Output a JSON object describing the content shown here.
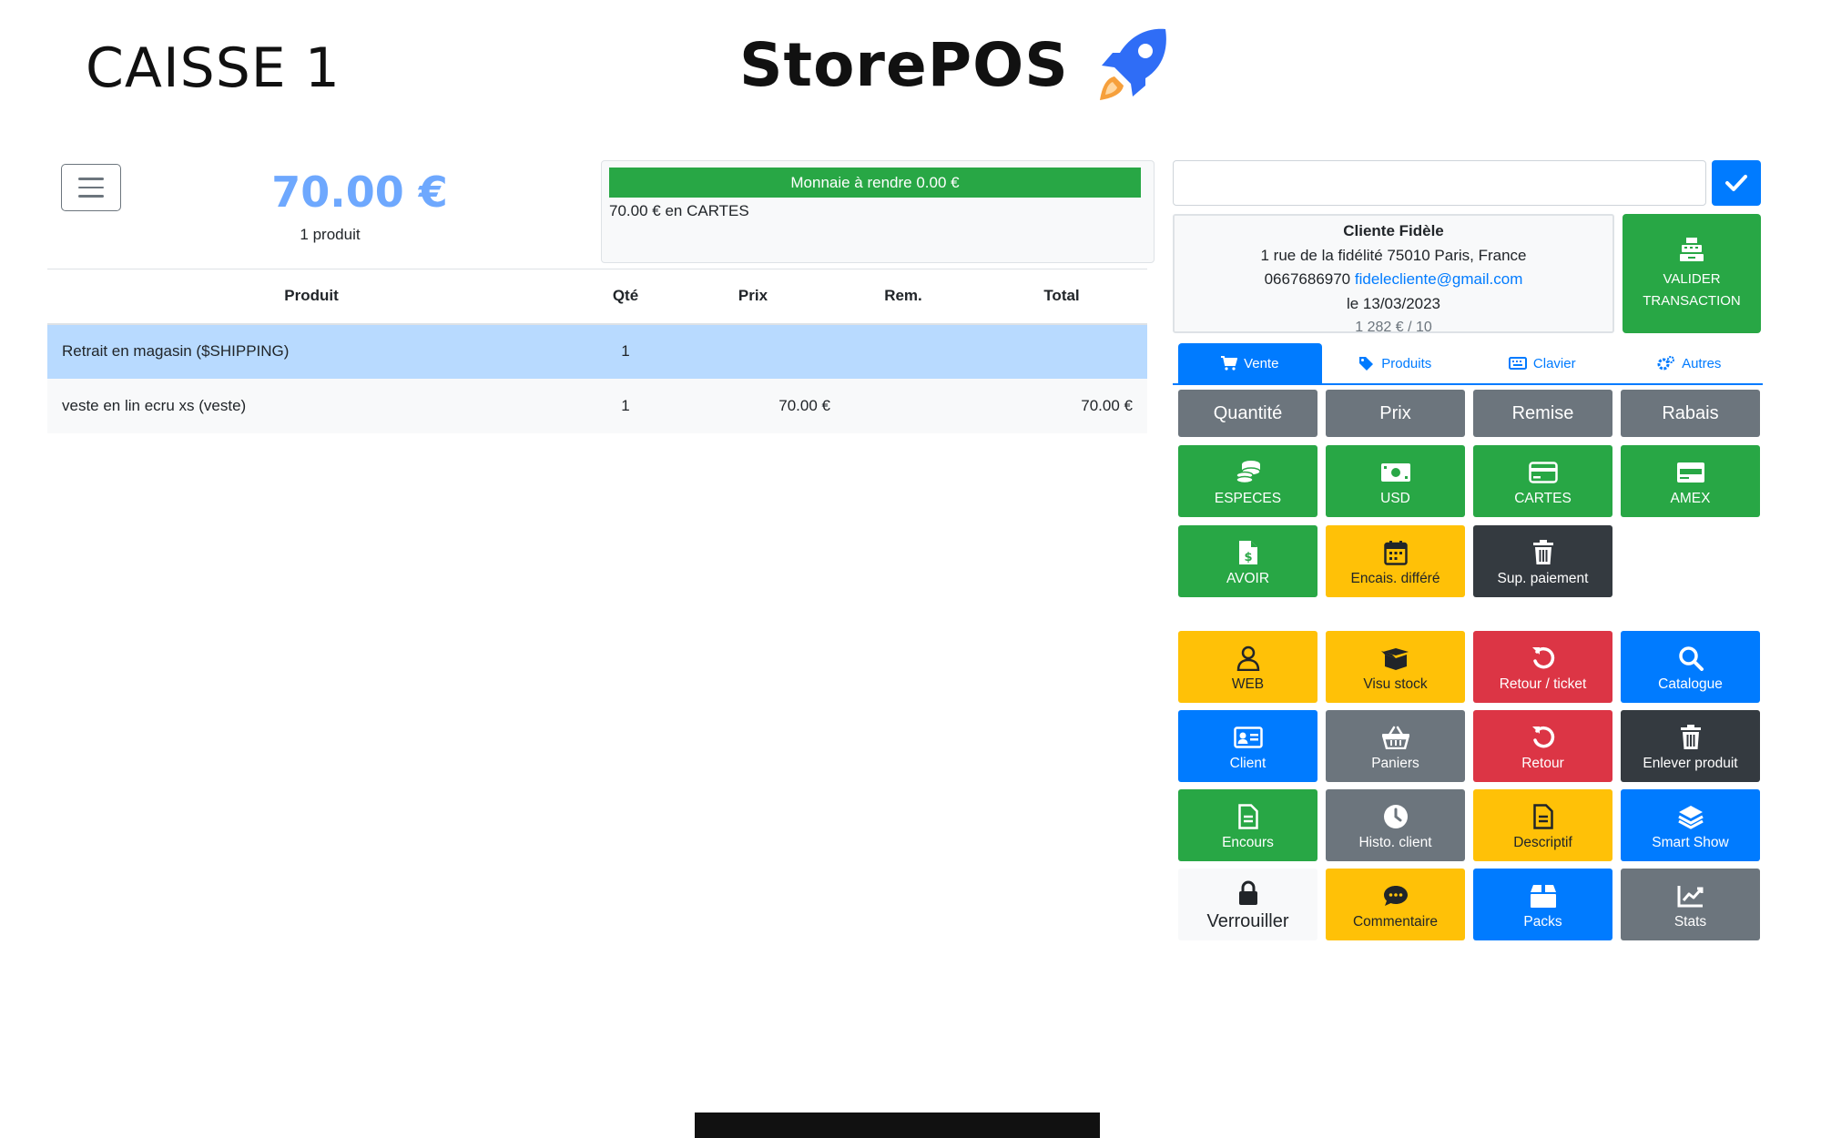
{
  "header": {
    "register_title": "CAISSE 1",
    "brand": "StorePOS"
  },
  "totals": {
    "amount": "70.00 €",
    "count": "1 produit"
  },
  "payment": {
    "change_due": "Monnaie à rendre 0.00 €",
    "lines": [
      "70.00 € en CARTES"
    ]
  },
  "cart": {
    "headers": [
      "Produit",
      "Qté",
      "Prix",
      "Rem.",
      "Total"
    ],
    "rows": [
      {
        "product": "Retrait en magasin ($SHIPPING)",
        "qty": "1",
        "price": "",
        "discount": "",
        "total": ""
      },
      {
        "product": "veste en lin ecru xs (veste)",
        "qty": "1",
        "price": "70.00 €",
        "discount": "",
        "total": "70.00 €"
      }
    ]
  },
  "search": {
    "value": "",
    "placeholder": ""
  },
  "client": {
    "name": "Cliente Fidèle",
    "address": "1 rue de la fidélité 75010 Paris, France",
    "phone": "0667686970",
    "email": "fidelecliente@gmail.com",
    "date": "le 13/03/2023",
    "stats": "1 282 € / 10"
  },
  "validate": {
    "line1": "VALIDER",
    "line2": "TRANSACTION"
  },
  "tabs": [
    "Vente",
    "Produits",
    "Clavier",
    "Autres"
  ],
  "sale_buttons": {
    "quantite": "Quantité",
    "prix": "Prix",
    "remise": "Remise",
    "rabais": "Rabais",
    "especes": "ESPECES",
    "usd": "USD",
    "cartes": "CARTES",
    "amex": "AMEX",
    "avoir": "AVOIR",
    "encais_differe": "Encais. différé",
    "sup_paiement": "Sup. paiement"
  },
  "action_buttons": {
    "web": "WEB",
    "visu_stock": "Visu stock",
    "retour_ticket": "Retour / ticket",
    "catalogue": "Catalogue",
    "client": "Client",
    "paniers": "Paniers",
    "retour": "Retour",
    "enlever_produit": "Enlever produit",
    "encours": "Encours",
    "histo_client": "Histo. client",
    "descriptif": "Descriptif",
    "smart_show": "Smart Show",
    "verrouiller": "Verrouiller",
    "commentaire": "Commentaire",
    "packs": "Packs",
    "stats": "Stats"
  },
  "colors": {
    "primary": "#007bff",
    "success": "#28a745",
    "secondary": "#6c757d",
    "danger": "#dc3545",
    "dark": "#343a40",
    "warning": "#ffc107",
    "total_amount": "#6ea8fe",
    "selected_row": "#b8daff"
  }
}
